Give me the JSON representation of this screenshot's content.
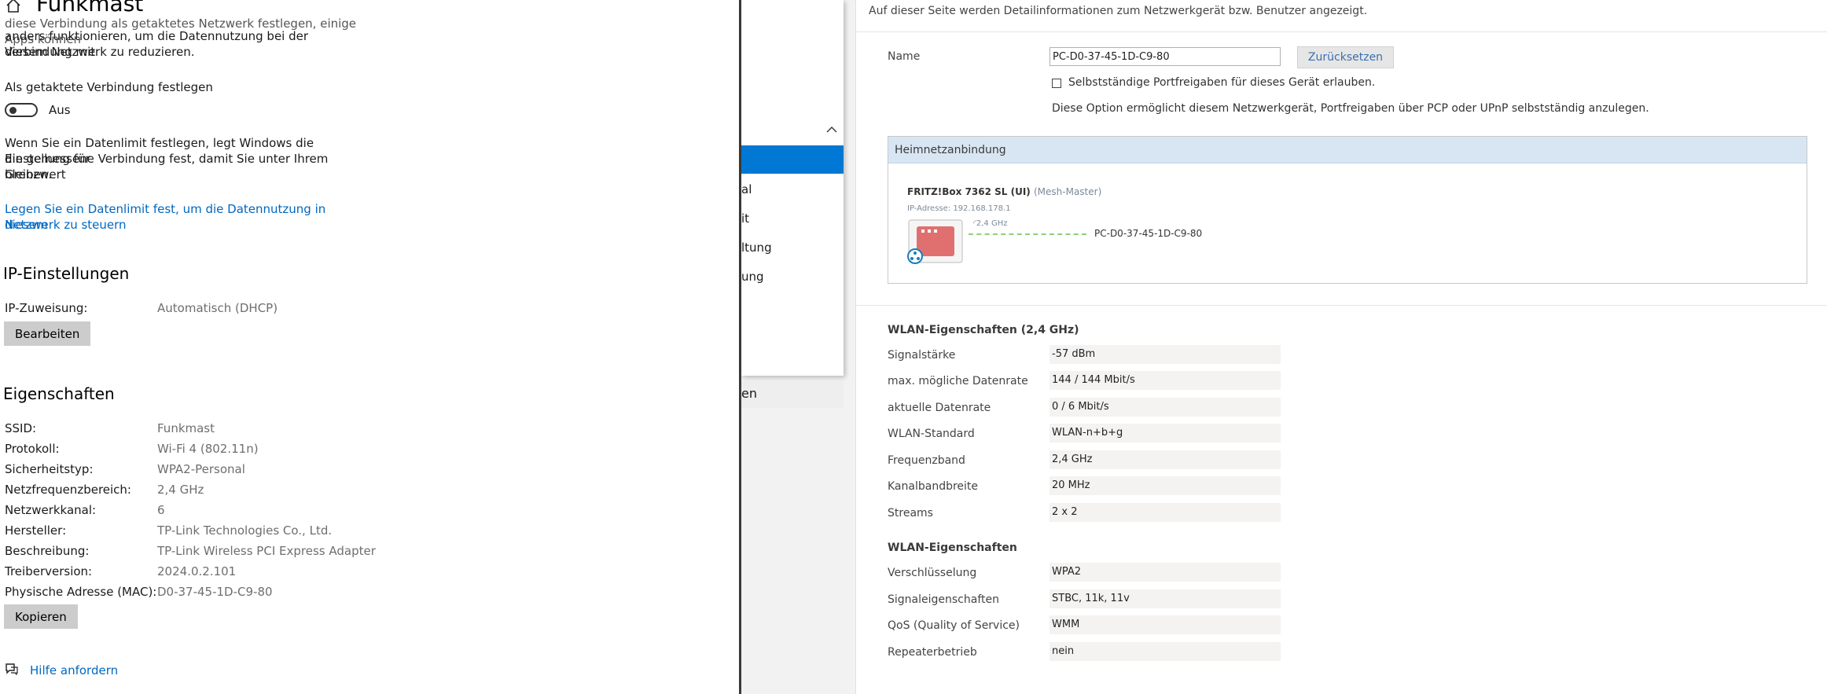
{
  "settings": {
    "title": "Funkmast",
    "intro_lines": [
      "diese Verbindung als getaktetes Netzwerk festlegen, einige Apps können",
      "anders funktionieren, um die Datennutzung bei der Verbindung mit",
      "diesem Netzwerk zu reduzieren."
    ],
    "metered_label": "Als getaktete Verbindung festlegen",
    "toggle_state": "Aus",
    "data_limit_lines": [
      "Wenn Sie ein Datenlimit festlegen, legt Windows die Einstellung für",
      "die gemessene Verbindung fest, damit Sie unter Ihrem Grenzwert",
      "bleiben."
    ],
    "data_limit_link_lines": [
      "Legen Sie ein Datenlimit fest, um die Datennutzung in diesem",
      "Netzwerk zu steuern"
    ],
    "ip_heading": "IP-Einstellungen",
    "ip_assign_label": "IP-Zuweisung:",
    "ip_assign_value": "Automatisch (DHCP)",
    "edit_button": "Bearbeiten",
    "props_heading": "Eigenschaften",
    "properties": [
      {
        "k": "SSID:",
        "v": "Funkmast"
      },
      {
        "k": "Protokoll:",
        "v": "Wi-Fi 4 (802.11n)"
      },
      {
        "k": "Sicherheitstyp:",
        "v": "WPA2-Personal"
      },
      {
        "k": "Netzfrequenzbereich:",
        "v": "2,4 GHz"
      },
      {
        "k": "Netzwerkkanal:",
        "v": "6"
      },
      {
        "k": "Hersteller:",
        "v": "TP-Link Technologies Co., Ltd."
      },
      {
        "k": "Beschreibung:",
        "v": "TP-Link Wireless PCI Express Adapter"
      },
      {
        "k": "Treiberversion:",
        "v": "2024.0.2.101"
      },
      {
        "k": "Physische Adresse (MAC):",
        "v": "D0-37-45-1D-C9-80"
      }
    ],
    "copy_button": "Kopieren",
    "help_link": "Hilfe anfordern"
  },
  "behind": {
    "items": [
      "al",
      "it",
      "ltung",
      "ung"
    ],
    "bottom": "en",
    "accent": "#0078d4"
  },
  "fritz": {
    "intro": "Auf dieser Seite werden Detailinformationen zum Netzwerkgerät bzw. Benutzer angezeigt.",
    "name_label": "Name",
    "name_value": "PC-D0-37-45-1D-C9-80",
    "reset_button": "Zurücksetzen",
    "portfreigabe_label": "Selbstständige Portfreigaben für dieses Gerät erlauben.",
    "portfreigabe_note": "Diese Option ermöglicht diesem Netzwerkgerät, Portfreigaben über PCP oder UPnP selbstständig anzulegen.",
    "heimnetz_title": "Heimnetzanbindung",
    "router_name": "FRITZ!Box 7362 SL (UI)",
    "router_role": "(Mesh-Master)",
    "router_ip": "IP-Adresse: 192.168.178.1",
    "link_band": "2,4 GHz",
    "client_name": "PC-D0-37-45-1D-C9-80",
    "wlan_title": "WLAN-Eigenschaften (2,4 GHz)",
    "wlan_props": [
      {
        "k": "Signalstärke",
        "v": "-57 dBm"
      },
      {
        "k": "max. mögliche Datenrate",
        "v": "144 / 144 Mbit/s"
      },
      {
        "k": "aktuelle Datenrate",
        "v": "0 / 6 Mbit/s"
      },
      {
        "k": "WLAN-Standard",
        "v": "WLAN-n+b+g"
      },
      {
        "k": "Frequenzband",
        "v": "2,4 GHz"
      },
      {
        "k": "Kanalbandbreite",
        "v": "20 MHz"
      },
      {
        "k": "Streams",
        "v": "2 x 2"
      }
    ],
    "wlan2_title": "WLAN-Eigenschaften",
    "wlan2_props": [
      {
        "k": "Verschlüsselung",
        "v": "WPA2"
      },
      {
        "k": "Signaleigenschaften",
        "v": "STBC, 11k, 11v"
      },
      {
        "k": "QoS (Quality of Service)",
        "v": "WMM"
      },
      {
        "k": "Repeaterbetrieb",
        "v": "nein"
      }
    ]
  }
}
